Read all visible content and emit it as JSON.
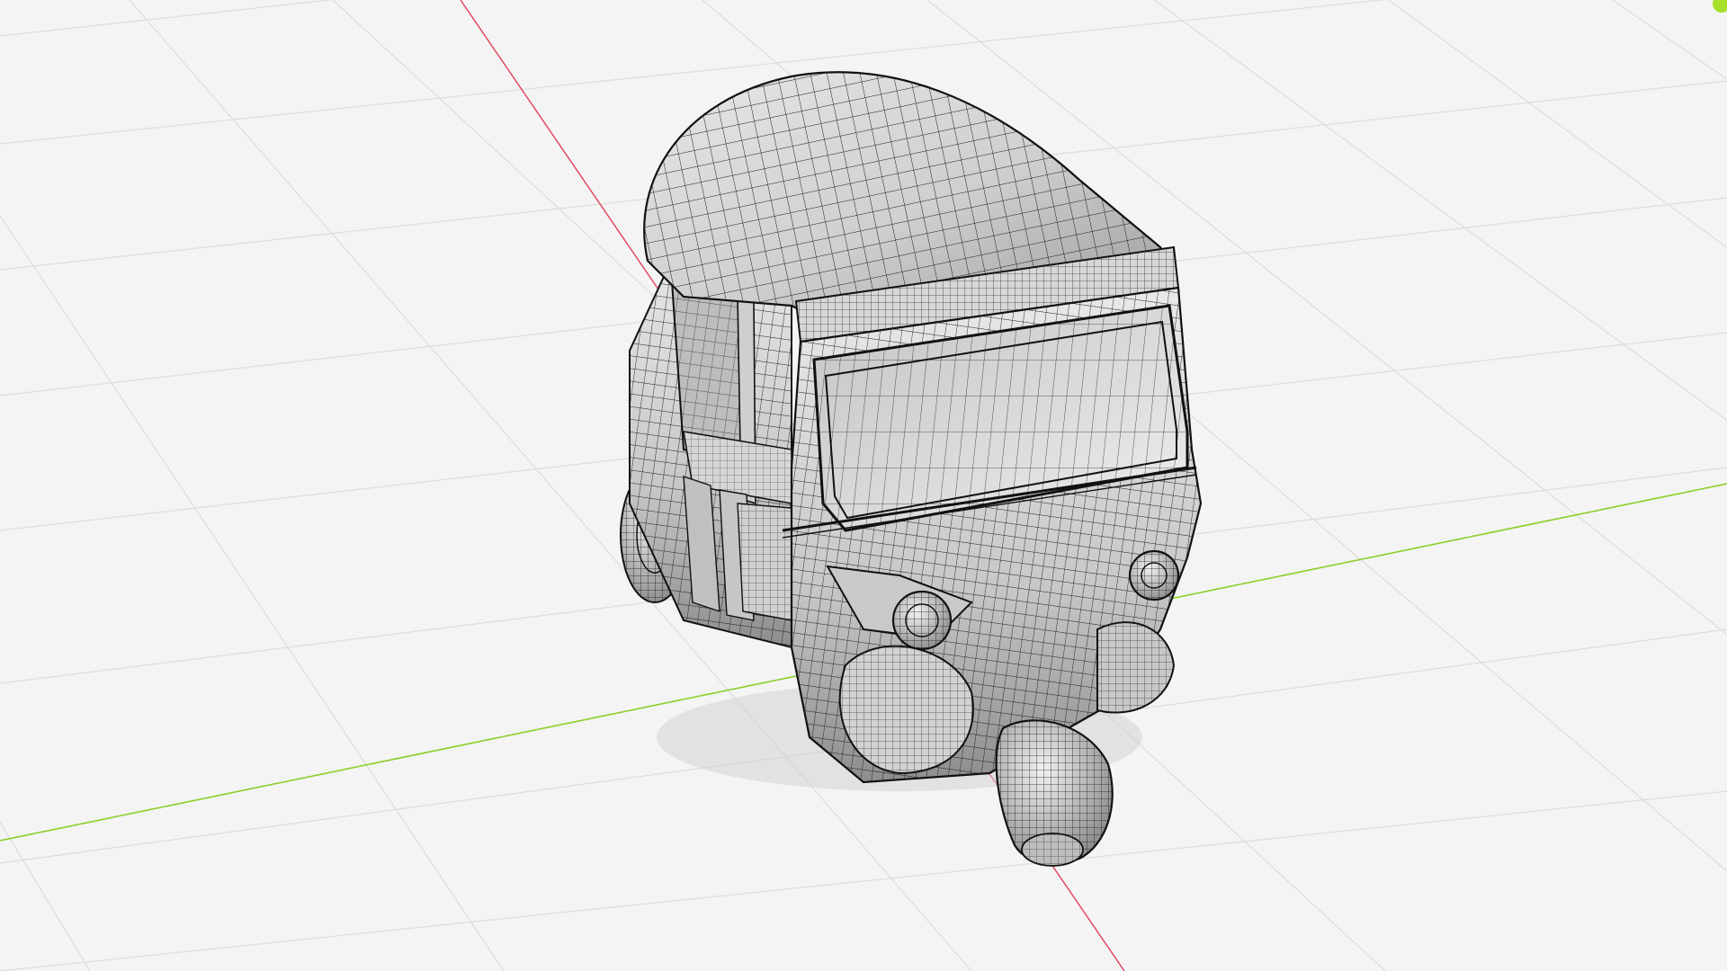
{
  "viewport": {
    "background_color": "#f4f4f4",
    "grid_color": "#dcdcdc",
    "x_axis_color": "#e0405a",
    "y_axis_color": "#8ccf2a",
    "status_indicator_color": "#a6e02a"
  },
  "model": {
    "shading": "wireframe-on-shaded",
    "surface_color": "#d9d9d9",
    "wire_color": "#1a1a1a"
  }
}
